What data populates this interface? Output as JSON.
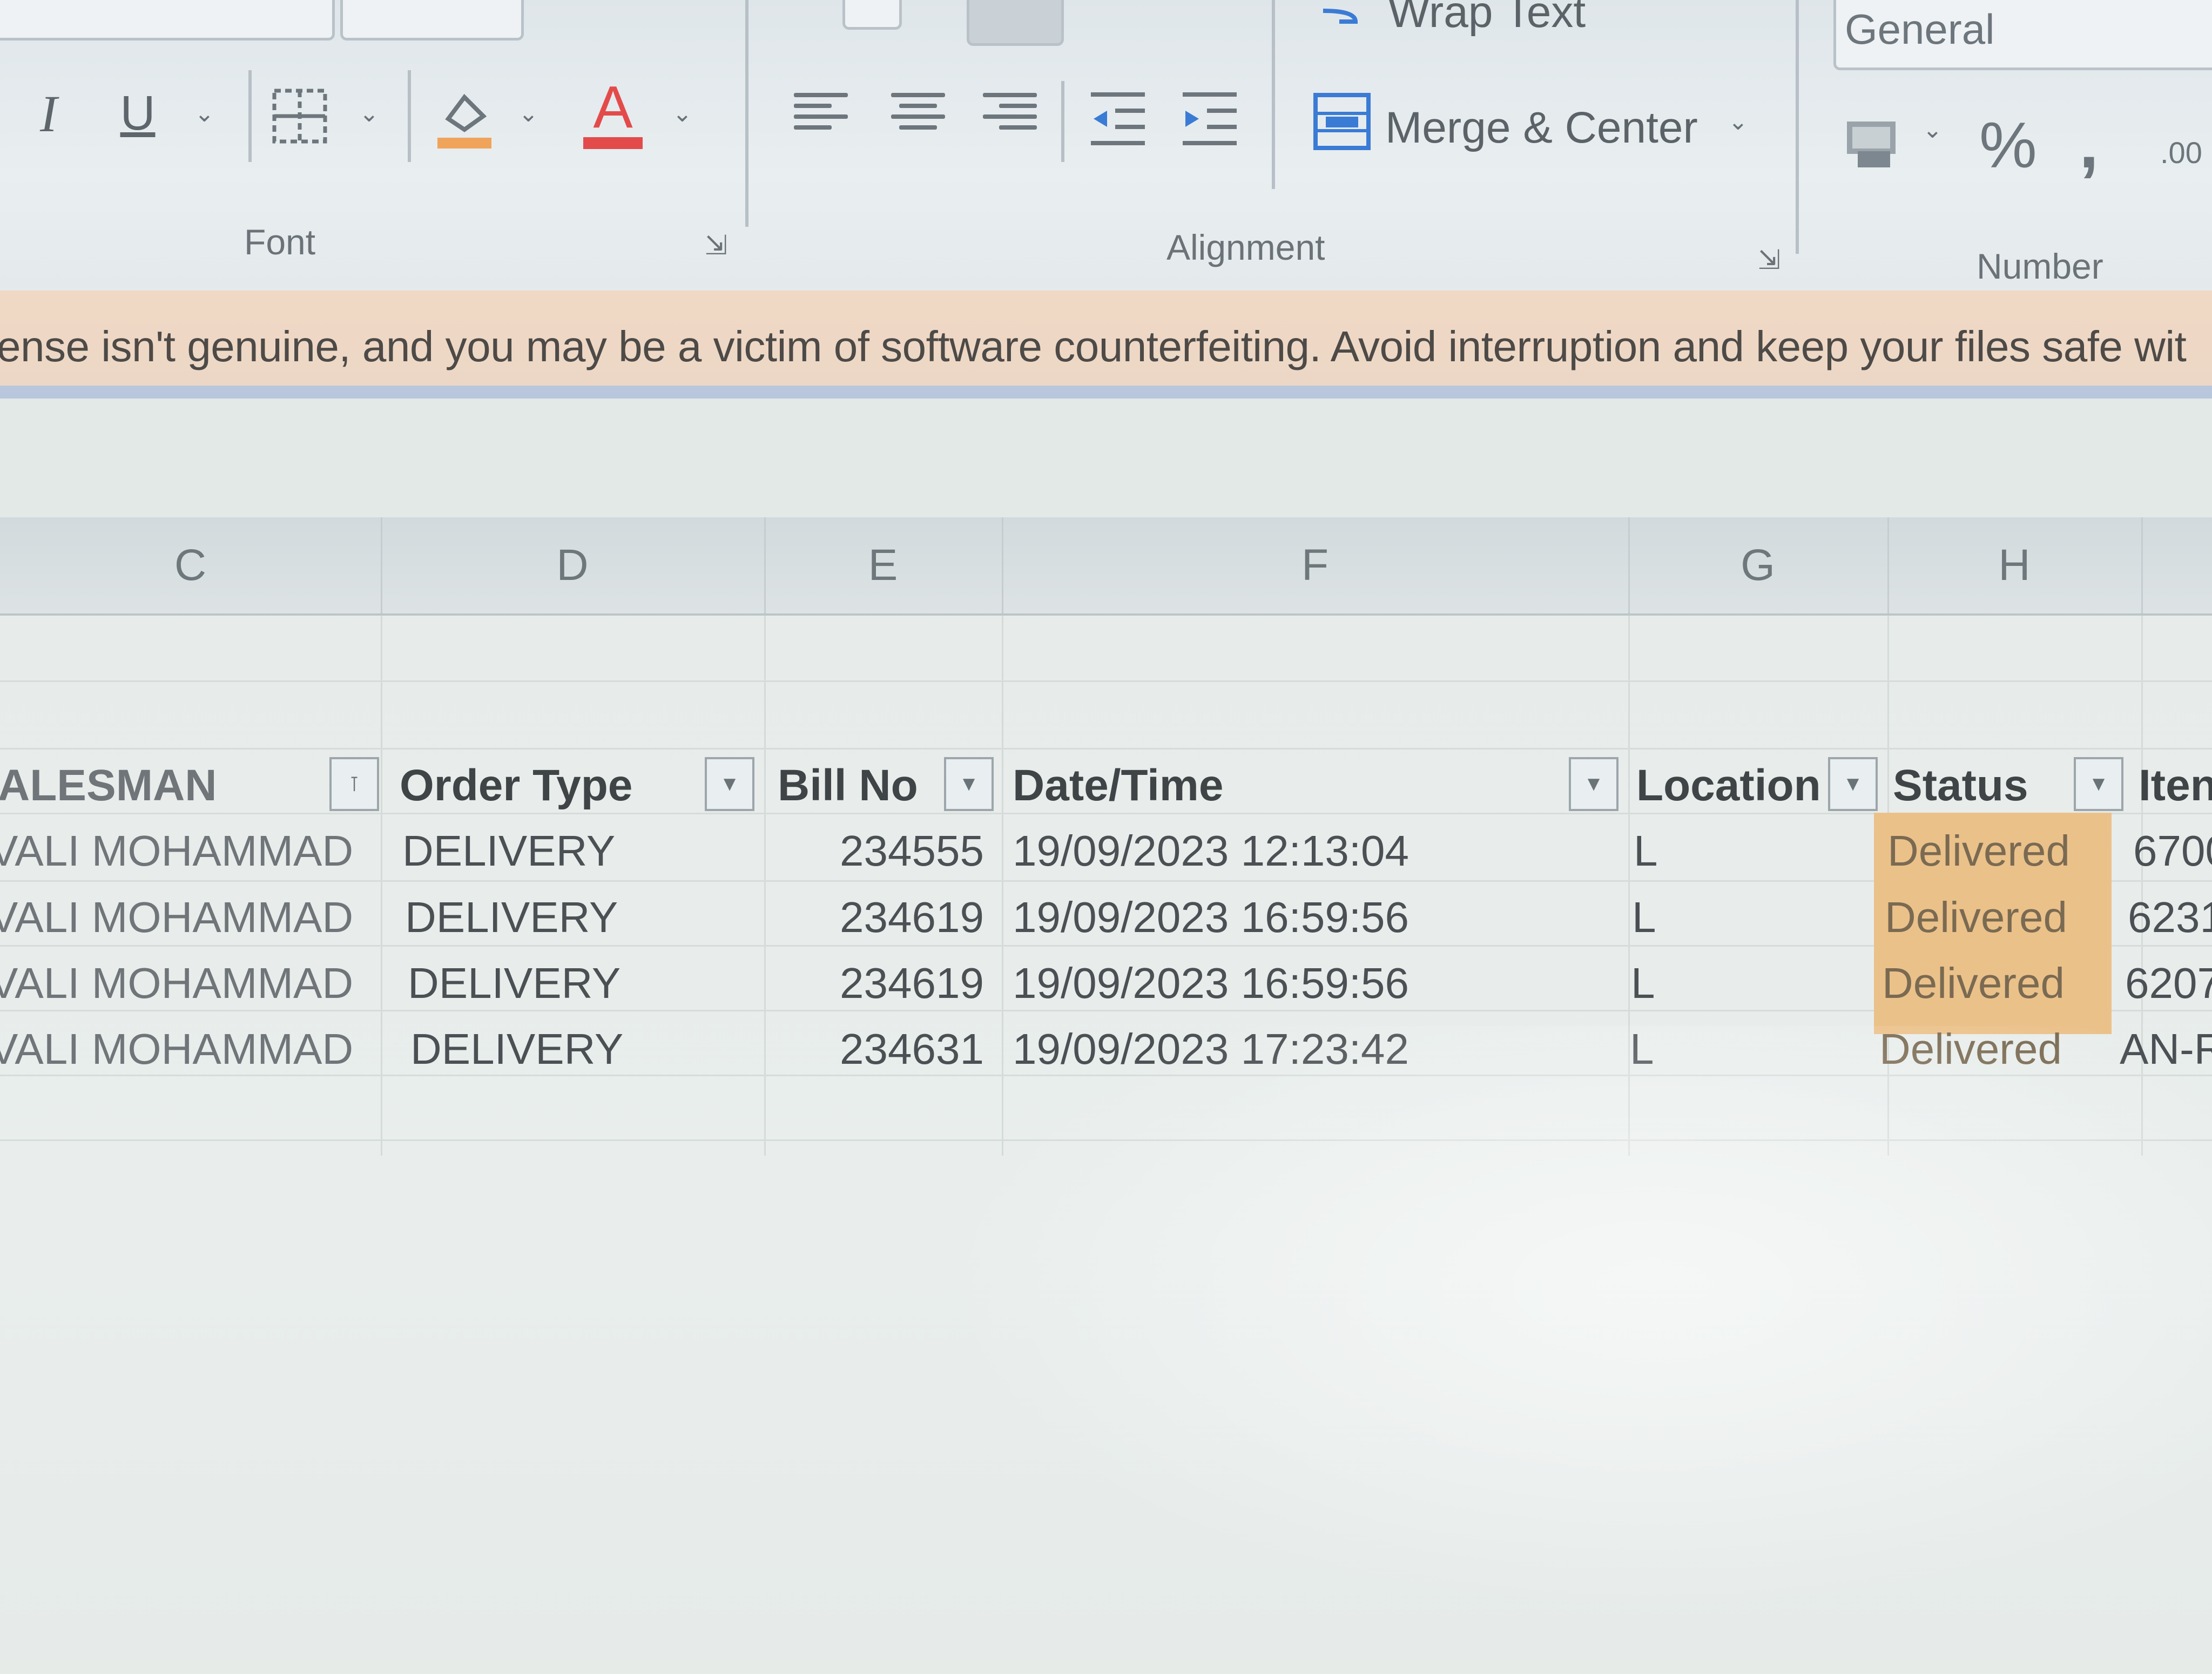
{
  "ribbon": {
    "groups": {
      "font": {
        "label": "Font",
        "italic": "I",
        "underline": "U",
        "font_color_glyph": "A"
      },
      "alignment": {
        "label": "Alignment",
        "wrap_text": "Wrap Text",
        "merge_center": "Merge & Center"
      },
      "number": {
        "label": "Number",
        "format_value": "General",
        "percent": "%",
        "comma": ",",
        "increase_decimal": ".00"
      }
    }
  },
  "warning": {
    "text": "ense isn't genuine, and you may be a victim of software counterfeiting. Avoid interruption and keep your files safe wit"
  },
  "columns": [
    "C",
    "D",
    "E",
    "F",
    "G",
    "H"
  ],
  "table": {
    "headers": [
      "ALESMAN",
      "Order Type",
      "Bill No",
      "Date/Time",
      "Location",
      "Status",
      "Iten"
    ],
    "rows": [
      {
        "salesman": "VALI MOHAMMAD",
        "order_type": "DELIVERY",
        "bill_no": "234555",
        "datetime": "19/09/2023 12:13:04",
        "location": "L",
        "status": "Delivered",
        "item": "6700"
      },
      {
        "salesman": "VALI MOHAMMAD",
        "order_type": "DELIVERY",
        "bill_no": "234619",
        "datetime": "19/09/2023 16:59:56",
        "location": "L",
        "status": "Delivered",
        "item": "6231"
      },
      {
        "salesman": "VALI MOHAMMAD",
        "order_type": "DELIVERY",
        "bill_no": "234619",
        "datetime": "19/09/2023 16:59:56",
        "location": "L",
        "status": "Delivered",
        "item": "6207"
      },
      {
        "salesman": "VALI MOHAMMAD",
        "order_type": "DELIVERY",
        "bill_no": "234631",
        "datetime": "19/09/2023 17:23:42",
        "location": "L",
        "status": "Delivered",
        "item": "AN-R"
      }
    ]
  },
  "colors": {
    "status_fill": "#ebc18a",
    "warning_bar": "#f0d9c4",
    "font_color_underline": "#e34b4b",
    "fill_color_underline": "#f0a35a"
  }
}
